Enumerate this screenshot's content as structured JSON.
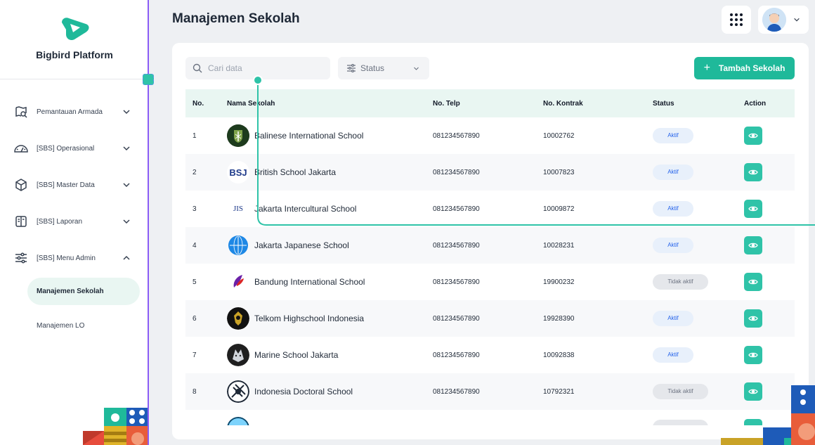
{
  "sidebar": {
    "brand": "Bigbird Platform",
    "menu": [
      {
        "label": "Pemantauan Armada",
        "icon": "map-search-icon",
        "expanded": false
      },
      {
        "label": "[SBS] Operasional",
        "icon": "dashboard-gauge-icon",
        "expanded": false
      },
      {
        "label": "[SBS] Master Data",
        "icon": "cube-icon",
        "expanded": false
      },
      {
        "label": "[SBS] Laporan",
        "icon": "report-icon",
        "expanded": false
      },
      {
        "label": "[SBS] Menu Admin",
        "icon": "sliders-icon",
        "expanded": true
      }
    ],
    "submenu": [
      {
        "label": "Manajemen Sekolah",
        "active": true
      },
      {
        "label": "Manajemen LO",
        "active": false
      }
    ]
  },
  "header": {
    "title": "Manajemen Sekolah"
  },
  "toolbar": {
    "search_placeholder": "Cari data",
    "status_label": "Status",
    "add_label": "Tambah Sekolah"
  },
  "table": {
    "columns": [
      "No.",
      "Nama Sekolah",
      "No. Telp",
      "No. Kontrak",
      "Status",
      "Action"
    ],
    "rows": [
      {
        "no": "1",
        "name": "Balinese International School",
        "telp": "081234567890",
        "kontrak": "10002762",
        "status": "Aktif",
        "active": true
      },
      {
        "no": "2",
        "name": "British School Jakarta",
        "telp": "081234567890",
        "kontrak": "10007823",
        "status": "Aktif",
        "active": true
      },
      {
        "no": "3",
        "name": "Jakarta Intercultural School",
        "telp": "081234567890",
        "kontrak": "10009872",
        "status": "Aktif",
        "active": true
      },
      {
        "no": "4",
        "name": "Jakarta Japanese School",
        "telp": "081234567890",
        "kontrak": "10028231",
        "status": "Aktif",
        "active": true
      },
      {
        "no": "5",
        "name": "Bandung International School",
        "telp": "081234567890",
        "kontrak": "19900232",
        "status": "Tidak aktif",
        "active": false
      },
      {
        "no": "6",
        "name": "Telkom Highschool Indonesia",
        "telp": "081234567890",
        "kontrak": "19928390",
        "status": "Aktif",
        "active": true
      },
      {
        "no": "7",
        "name": "Marine School Jakarta",
        "telp": "081234567890",
        "kontrak": "10092838",
        "status": "Aktif",
        "active": true
      },
      {
        "no": "8",
        "name": "Indonesia Doctoral School",
        "telp": "081234567890",
        "kontrak": "10792321",
        "status": "Tidak aktif",
        "active": false
      }
    ]
  },
  "school_logos": {
    "bsj": "BSJ",
    "jis": "JIS"
  },
  "colors": {
    "accent": "#1fb99a",
    "accent_light": "#2fc3a8",
    "header_row": "#e9f6f2",
    "badge_active_bg": "#e8f0fb",
    "badge_active_text": "#2563eb",
    "badge_inactive_bg": "#e5e7eb",
    "sidebar_border": "#8b5cf6"
  }
}
